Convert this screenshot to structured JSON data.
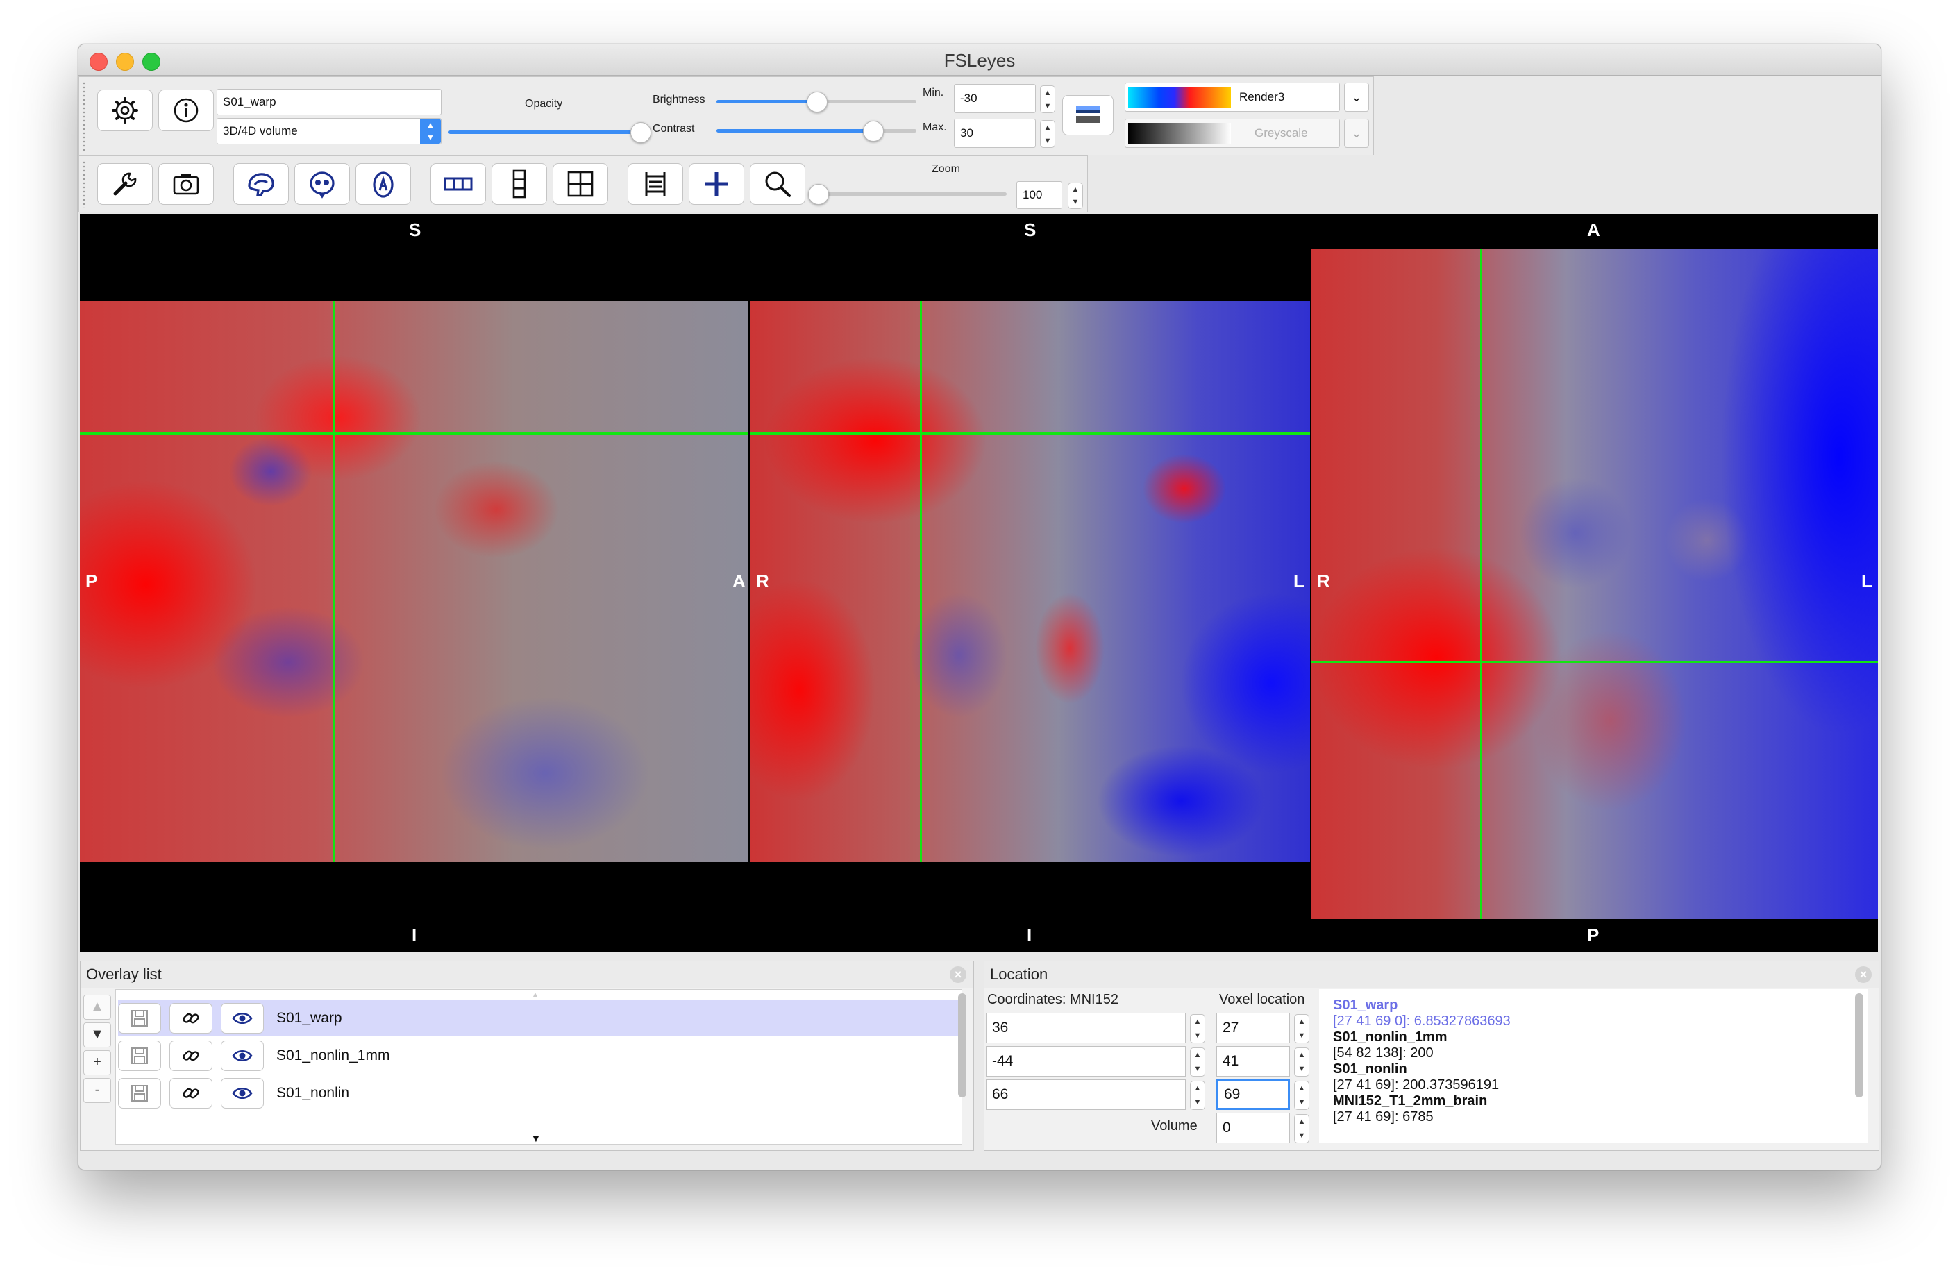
{
  "window": {
    "title": "FSLeyes"
  },
  "overlay_toolbar": {
    "overlay_name": "S01_warp",
    "overlay_type": "3D/4D volume",
    "opacity_label": "Opacity",
    "opacity": 1.0,
    "brightness_label": "Brightness",
    "brightness": 0.5,
    "contrast_label": "Contrast",
    "contrast": 0.78,
    "min_label": "Min.",
    "min_value": "-30",
    "max_label": "Max.",
    "max_value": "30",
    "colormap_name": "Render3",
    "neg_colormap_name": "Greyscale"
  },
  "ortho_toolbar": {
    "zoom_label": "Zoom",
    "zoom_value": "100",
    "zoom": 0.0
  },
  "views": {
    "sagittal": {
      "top": "S",
      "bottom": "I",
      "left": "P",
      "right": "A"
    },
    "coronal": {
      "top": "S",
      "bottom": "I",
      "left": "R",
      "right": "L"
    },
    "axial": {
      "top": "A",
      "bottom": "P",
      "left": "R",
      "right": "L"
    }
  },
  "overlay_list": {
    "title": "Overlay list",
    "buttons": [
      "▲",
      "▼",
      "+",
      "-"
    ],
    "items": [
      {
        "name": "S01_warp",
        "selected": true
      },
      {
        "name": "S01_nonlin_1mm",
        "selected": false
      },
      {
        "name": "S01_nonlin",
        "selected": false
      }
    ]
  },
  "location": {
    "title": "Location",
    "coords_label": "Coordinates: MNI152",
    "voxel_label": "Voxel location",
    "coords": [
      "36",
      "-44",
      "66"
    ],
    "voxels": [
      "27",
      "41",
      "69"
    ],
    "volume_label": "Volume",
    "volume": "0",
    "info": [
      {
        "name": "S01_warp",
        "value": "[27 41 69 0]: 6.85327863693",
        "highlight": true
      },
      {
        "name": "S01_nonlin_1mm",
        "value": "[54 82 138]: 200",
        "highlight": false
      },
      {
        "name": "S01_nonlin",
        "value": "[27 41 69]: 200.373596191",
        "highlight": false
      },
      {
        "name": "MNI152_T1_2mm_brain",
        "value": "[27 41 69]: 6785",
        "highlight": false
      }
    ]
  },
  "colors": {
    "accent": "#3b8df5",
    "crosshair": "#12e612",
    "selected_row": "#d7d9fb",
    "highlight_text": "#6b6ee6"
  }
}
